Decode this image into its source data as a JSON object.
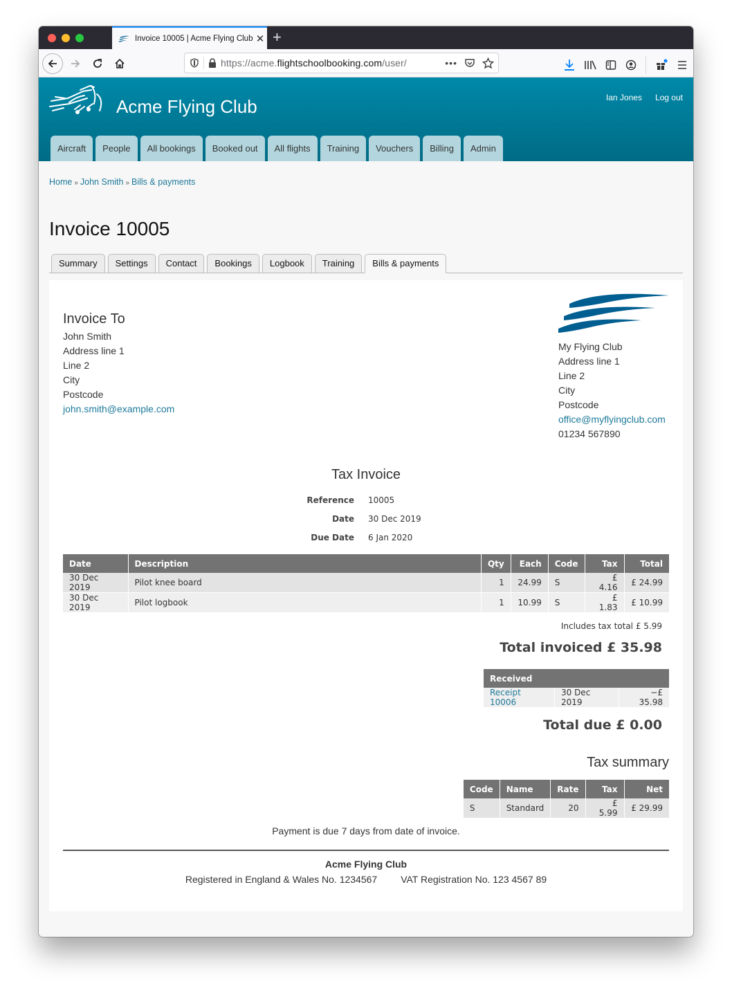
{
  "browser": {
    "tab_title": "Invoice 10005 | Acme Flying Club",
    "url_prefix": "https://acme.",
    "url_domain": "flightschoolbooking.com",
    "url_path": "/user/",
    "accent_color": "#0a84ff"
  },
  "site": {
    "title": "Acme Flying Club",
    "user_name": "Ian Jones",
    "logout_label": "Log out",
    "header_color": "#007c99",
    "nav": [
      "Aircraft",
      "People",
      "All bookings",
      "Booked out",
      "All flights",
      "Training",
      "Vouchers",
      "Billing",
      "Admin"
    ]
  },
  "breadcrumb": {
    "items": [
      "Home",
      "John Smith",
      "Bills & payments"
    ],
    "separator": "»"
  },
  "page": {
    "title": "Invoice 10005",
    "tabs": [
      "Summary",
      "Settings",
      "Contact",
      "Bookings",
      "Logbook",
      "Training",
      "Bills & payments"
    ],
    "active_tab": "Bills & payments"
  },
  "invoice": {
    "to_heading": "Invoice To",
    "to": {
      "name": "John Smith",
      "address1": "Address line 1",
      "address2": "Line 2",
      "city": "City",
      "postcode": "Postcode",
      "email": "john.smith@example.com"
    },
    "from": {
      "name": "My Flying Club",
      "address1": "Address line 1",
      "address2": "Line 2",
      "city": "City",
      "postcode": "Postcode",
      "email": "office@myflyingclub.com",
      "phone": "01234 567890"
    },
    "doc_title": "Tax Invoice",
    "meta": [
      {
        "label": "Reference",
        "value": "10005"
      },
      {
        "label": "Date",
        "value": "30 Dec 2019"
      },
      {
        "label": "Due Date",
        "value": "6 Jan 2020"
      }
    ],
    "items_headers": [
      "Date",
      "Description",
      "Qty",
      "Each",
      "Code",
      "Tax",
      "Total"
    ],
    "items": [
      {
        "date": "30 Dec 2019",
        "description": "Pilot knee board",
        "qty": "1",
        "each": "24.99",
        "code": "S",
        "tax": "£ 4.16",
        "total": "£ 24.99"
      },
      {
        "date": "30 Dec 2019",
        "description": "Pilot logbook",
        "qty": "1",
        "each": "10.99",
        "code": "S",
        "tax": "£ 1.83",
        "total": "£ 10.99"
      }
    ],
    "tax_total_note": "Includes tax total £ 5.99",
    "total_invoiced": "Total invoiced £ 35.98",
    "received_header": "Received",
    "received": [
      {
        "receipt": "Receipt 10006",
        "date": "30 Dec 2019",
        "amount": "−£ 35.98"
      }
    ],
    "total_due": "Total due £ 0.00",
    "tax_summary_title": "Tax summary",
    "tax_summary_headers": [
      "Code",
      "Name",
      "Rate",
      "Tax",
      "Net"
    ],
    "tax_summary": [
      {
        "code": "S",
        "name": "Standard",
        "rate": "20",
        "tax": "£ 5.99",
        "net": "£ 29.99"
      }
    ],
    "payment_note": "Payment is due 7 days from date of invoice.",
    "footer_name": "Acme Flying Club",
    "footer_company_reg": "Registered in England & Wales No. 1234567",
    "footer_vat_reg": "VAT Registration No. 123 4567 89"
  }
}
